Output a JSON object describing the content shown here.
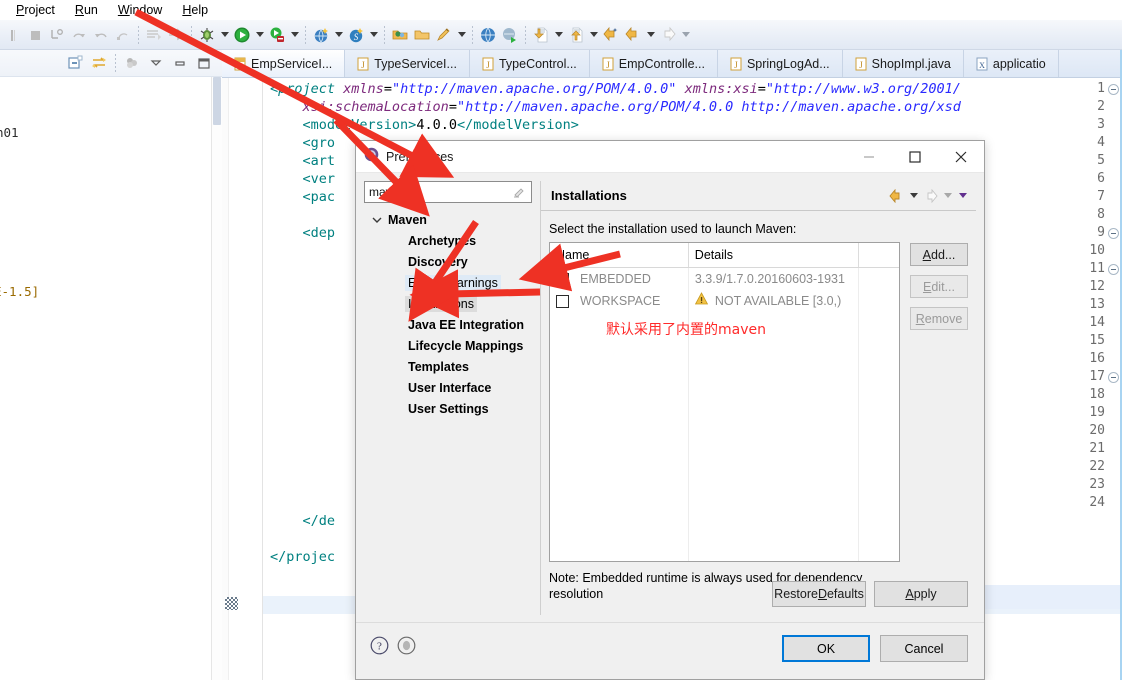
{
  "menu": {
    "items": [
      {
        "label": "Project",
        "mnemonic": "P"
      },
      {
        "label": "Run",
        "mnemonic": "R"
      },
      {
        "label": "Window",
        "mnemonic": "W"
      },
      {
        "label": "Help",
        "mnemonic": "H"
      }
    ]
  },
  "toolbar": {
    "icons": [
      "pause-icon",
      "stop-icon",
      "step-into-icon",
      "step-over-icon",
      "step-return-icon",
      "step-filter-icon",
      "skip-breakpoints-icon",
      "run-last-tool-icon",
      "debug-icon",
      "run-icon",
      "coverage-icon",
      "new-web-project-icon",
      "new-spring-icon",
      "open-type-icon",
      "open-resource-icon",
      "search-icon",
      "open-browser-icon",
      "run-server-icon",
      "forward-icon",
      "back-list-icon",
      "next-annotation-icon",
      "previous-edit-icon",
      "back-icon",
      "forward-nav-icon"
    ]
  },
  "left_view": {
    "toolbar_icons": [
      "collapse-all-icon",
      "link-with-editor-icon",
      "filter-icon",
      "view-menu-icon",
      "minimize-icon",
      "maximize-icon"
    ],
    "fragment_top": "n01",
    "fragment_bottom": "E-1.5]"
  },
  "editor": {
    "tabs": [
      {
        "label": "EmpServiceI...",
        "icon": "java-interface-icon",
        "active": true
      },
      {
        "label": "TypeServiceI...",
        "icon": "java-file-icon",
        "active": false
      },
      {
        "label": "TypeControl...",
        "icon": "java-file-icon",
        "active": false
      },
      {
        "label": "EmpControlle...",
        "icon": "java-file-icon",
        "active": false
      },
      {
        "label": "SpringLogAd...",
        "icon": "java-file-icon",
        "active": false
      },
      {
        "label": "ShopImpl.java",
        "icon": "java-file-icon",
        "active": false
      },
      {
        "label": "applicatio",
        "icon": "xml-file-icon",
        "active": false
      }
    ],
    "lines": [
      {
        "no": 1,
        "fold": true,
        "text": "<project xmlns=\"http://maven.apache.org/POM/4.0.0\" xmlns:xsi=\"http://www.w3.org/2001/"
      },
      {
        "no": 2,
        "fold": false,
        "text": "    xsi:schemaLocation=\"http://maven.apache.org/POM/4.0.0 http://maven.apache.org/xsd"
      },
      {
        "no": 3,
        "fold": false,
        "text": "    <modelVersion>4.0.0</modelVersion>"
      },
      {
        "no": 4,
        "fold": false,
        "text": "    <gro"
      },
      {
        "no": 5,
        "fold": false,
        "text": "    <art"
      },
      {
        "no": 6,
        "fold": false,
        "text": "    <ver"
      },
      {
        "no": 7,
        "fold": false,
        "text": "    <pac"
      },
      {
        "no": 8,
        "fold": false,
        "text": ""
      },
      {
        "no": 9,
        "fold": true,
        "text": "    <dep"
      },
      {
        "no": 10,
        "fold": false,
        "text": ""
      },
      {
        "no": 11,
        "fold": true,
        "text": ""
      },
      {
        "no": 12,
        "fold": false,
        "text": ""
      },
      {
        "no": 13,
        "fold": false,
        "text": ""
      },
      {
        "no": 14,
        "fold": false,
        "text": ""
      },
      {
        "no": 15,
        "fold": false,
        "text": ""
      },
      {
        "no": 16,
        "fold": false,
        "text": ""
      },
      {
        "no": 17,
        "fold": true,
        "text": ""
      },
      {
        "no": 18,
        "fold": false,
        "text": ""
      },
      {
        "no": 19,
        "fold": false,
        "text": ""
      },
      {
        "no": 20,
        "fold": false,
        "text": ""
      },
      {
        "no": 21,
        "fold": false,
        "text": ""
      },
      {
        "no": 22,
        "fold": false,
        "text": "    </de"
      },
      {
        "no": 23,
        "fold": false,
        "text": ""
      },
      {
        "no": 24,
        "fold": false,
        "text": "</projec"
      }
    ]
  },
  "dialog": {
    "title": "Preferences",
    "icon": "preferences-icon",
    "window_buttons": {
      "minimize": "—",
      "maximize": "☐",
      "close": "✕"
    },
    "filter": {
      "value": "maven",
      "clear_icon": "clear-icon"
    },
    "tree": [
      {
        "label": "Maven",
        "level": "root",
        "expanded": true,
        "state": "normal"
      },
      {
        "label": "Archetypes",
        "level": "child",
        "state": "normal"
      },
      {
        "label": "Discovery",
        "level": "child",
        "state": "normal"
      },
      {
        "label": "Errors/Warnings",
        "level": "child",
        "state": "match"
      },
      {
        "label": "Installations",
        "level": "child",
        "state": "selected"
      },
      {
        "label": "Java EE Integration",
        "level": "child",
        "state": "normal"
      },
      {
        "label": "Lifecycle Mappings",
        "level": "child",
        "state": "normal"
      },
      {
        "label": "Templates",
        "level": "child",
        "state": "normal"
      },
      {
        "label": "User Interface",
        "level": "child",
        "state": "normal"
      },
      {
        "label": "User Settings",
        "level": "child",
        "state": "normal"
      }
    ],
    "pane": {
      "title": "Installations",
      "nav_icons": [
        "back-arrow-icon",
        "back-dropdown-icon",
        "forward-arrow-icon",
        "forward-dropdown-icon",
        "view-menu-icon"
      ],
      "instruction": "Select the installation used to launch Maven:",
      "table": {
        "columns": [
          "Name",
          "Details",
          ""
        ],
        "rows": [
          {
            "checked": true,
            "name": "EMBEDDED",
            "details": "3.3.9/1.7.0.20160603-1931",
            "warning": false
          },
          {
            "checked": false,
            "name": "WORKSPACE",
            "details": "NOT AVAILABLE [3.0,)",
            "warning": true
          }
        ]
      },
      "annotation": "默认采用了内置的maven",
      "annotation_color": "#ff2a2a",
      "side_buttons": [
        {
          "label": "Add...",
          "mnemonic": "A",
          "disabled": false
        },
        {
          "label": "Edit...",
          "mnemonic": "E",
          "disabled": true
        },
        {
          "label": "Remove",
          "mnemonic": "R",
          "disabled": true
        }
      ],
      "note": "Note: Embedded runtime is always used for dependency resolution",
      "restore_defaults": "Restore Defaults",
      "restore_defaults_mnemonic": "D",
      "apply": "Apply",
      "apply_mnemonic": "A"
    },
    "footer": {
      "help_icon": "help-icon",
      "info_icon": "info-icon",
      "ok": "OK",
      "cancel": "Cancel",
      "ok_focus_color": "#0078d7"
    }
  },
  "annotations": {
    "arrow_color": "#ee3124",
    "arrows": [
      {
        "name": "arrow-to-preferences-title"
      },
      {
        "name": "arrow-to-filter-field"
      },
      {
        "name": "arrow-to-installations-node"
      },
      {
        "name": "arrow-to-embedded-checkbox"
      }
    ]
  }
}
